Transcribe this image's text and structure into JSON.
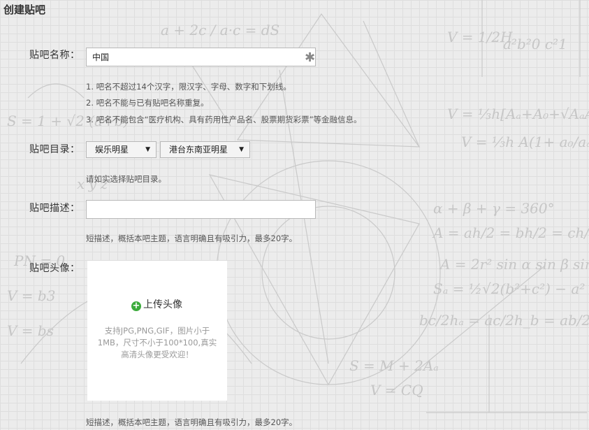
{
  "page": {
    "title": "创建贴吧"
  },
  "name_field": {
    "label": "贴吧名称：",
    "value": "中国",
    "required_mark": "✱",
    "hints": [
      "1. 吧名不超过14个汉字，限汉字、字母、数字和下划线。",
      "2. 吧名不能与已有贴吧名称重复。",
      "3. 吧名不能包含“医疗机构、具有药用性产品名、股票期货彩票”等金融信息。"
    ]
  },
  "category": {
    "label": "贴吧目录：",
    "primary": "娱乐明星",
    "secondary": "港台东南亚明星",
    "hint": "请如实选择贴吧目录。"
  },
  "description": {
    "label": "贴吧描述：",
    "value": "",
    "hint": "短描述，概括本吧主题，语言明确且有吸引力，最多20字。"
  },
  "avatar": {
    "label": "贴吧头像：",
    "upload_label": "上传头像",
    "hint": "支持JPG,PNG,GIF，图片小于1MB，尺寸不小于100*100,真实高清头像更受欢迎！"
  },
  "footer": {
    "hint": "短描述，概括本吧主题，语言明确且有吸引力，最多20字。"
  },
  "colors": {
    "background": "#ececec",
    "upload_icon": "#3cab3c"
  }
}
